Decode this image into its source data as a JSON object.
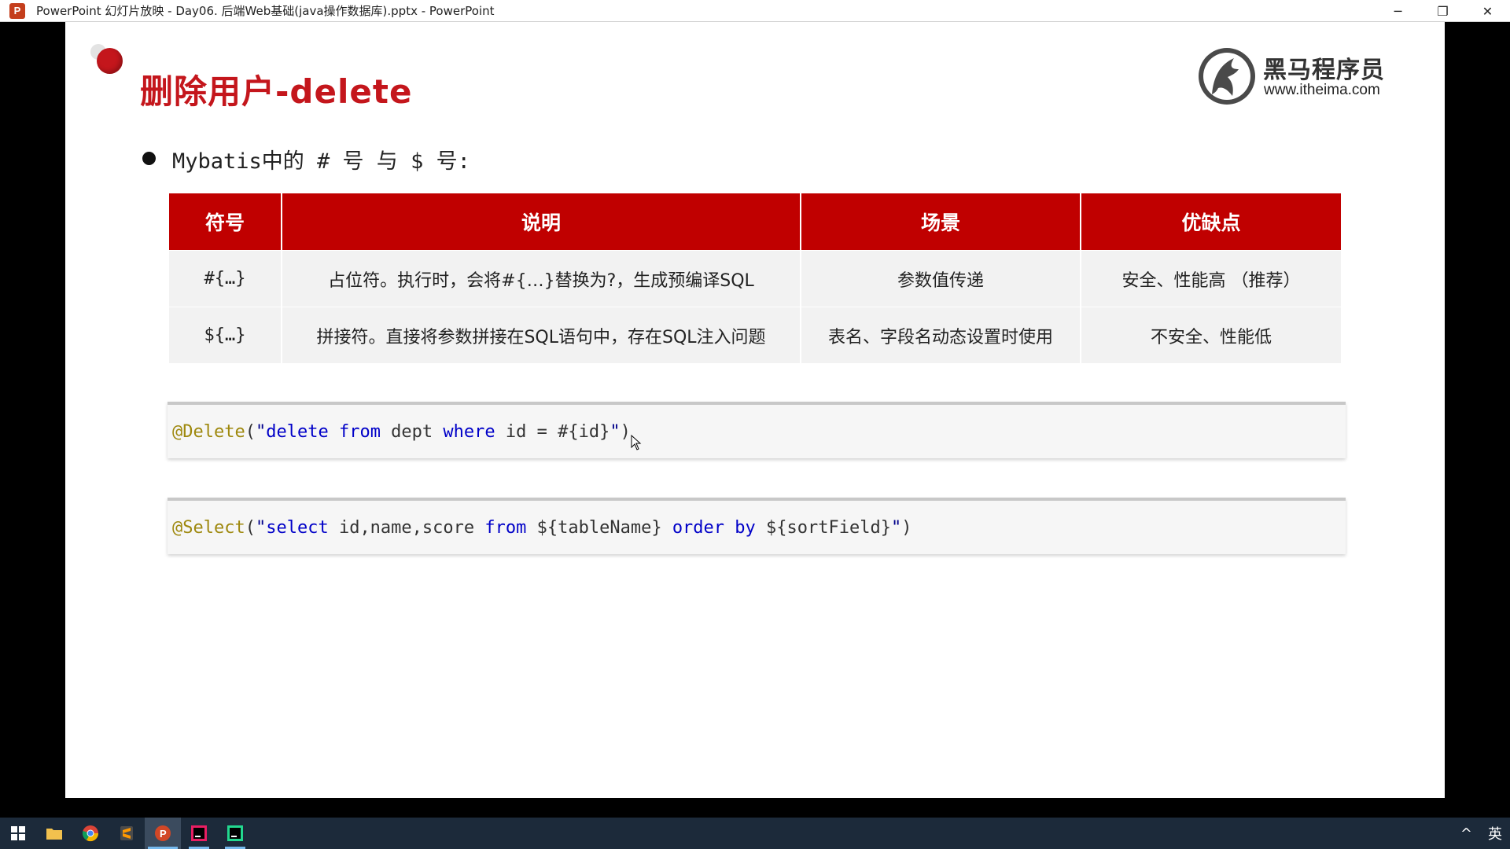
{
  "window": {
    "title": "PowerPoint 幻灯片放映  -  Day06. 后端Web基础(java操作数据库).pptx - PowerPoint",
    "app_icon_letter": "P",
    "minimize": "─",
    "restore": "❐",
    "close": "✕"
  },
  "slide": {
    "title": "删除用户-delete",
    "logo": {
      "cn": "黑马程序员",
      "url": "www.itheima.com"
    },
    "bullet": "Mybatis中的 # 号 与 $ 号:",
    "table": {
      "headers": [
        "符号",
        "说明",
        "场景",
        "优缺点"
      ],
      "rows": [
        [
          "#{…}",
          "占位符。执行时，会将#{…}替换为?，生成预编译SQL",
          "参数值传递",
          "安全、性能高 （推荐）"
        ],
        [
          "${…}",
          "拼接符。直接将参数拼接在SQL语句中，存在SQL注入问题",
          "表名、字段名动态设置时使用",
          "不安全、性能低"
        ]
      ]
    },
    "code1": {
      "annotation": "@Delete",
      "open": "(",
      "quote_open": "\"",
      "kw1": "delete",
      "kw2": "from",
      "ident1": " dept ",
      "kw3": "where",
      "rest": " id = #{id}",
      "quote_close": "\"",
      "close": ")"
    },
    "code2": {
      "annotation": "@Select",
      "open": "(",
      "quote_open": "\"",
      "kw1": "select",
      "ident1": " id,name,score ",
      "kw2": "from",
      "ident2": " ${tableName} ",
      "kw3": "order by",
      "ident3": " ${sortField}",
      "quote_close": "\"",
      "close": ")"
    },
    "watermark": "黑马程序员"
  },
  "taskbar": {
    "tray_ime": "英",
    "tray_arrow": "^"
  },
  "colors": {
    "brand_red": "#c4161c",
    "table_header": "#c00000",
    "taskbar": "#1c2a3a"
  }
}
